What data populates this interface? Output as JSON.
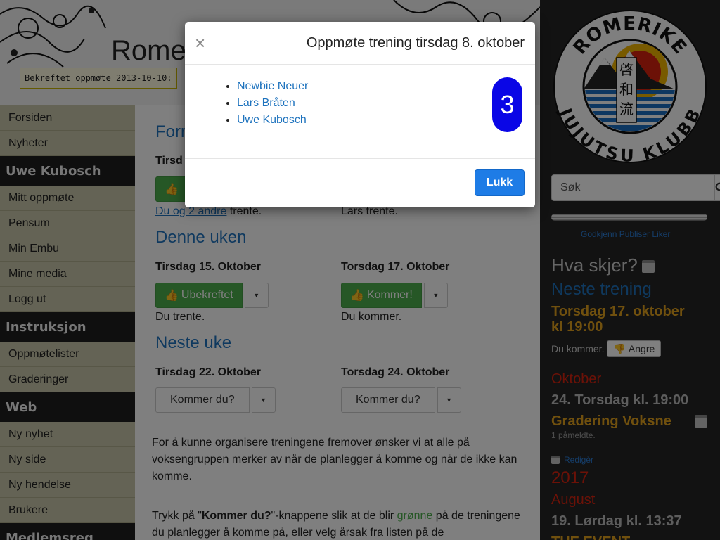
{
  "header": {
    "site_title": "Rome",
    "confirm_text": "Bekreftet oppmøte 2013-10-10:"
  },
  "nav": {
    "items_top": [
      "Forsiden",
      "Nyheter"
    ],
    "user_heading": "Uwe Kubosch",
    "user_items": [
      "Mitt oppmøte",
      "Pensum",
      "Min Embu",
      "Mine media",
      "Logg ut"
    ],
    "instr_heading": "Instruksjon",
    "instr_items": [
      "Oppmøtelister",
      "Graderinger"
    ],
    "web_heading": "Web",
    "web_items": [
      "Ny nyhet",
      "Ny side",
      "Ny hendelse",
      "Brukere"
    ],
    "member_heading": "Medlemsreg"
  },
  "main": {
    "section1_partial": "Forr",
    "day1_partial": "Tirsd",
    "status1_link": "Du og 2 andre",
    "status1_rest": " trente.",
    "status2": "Lars trente.",
    "this_week": "Denne uken",
    "tue15": "Tirsdag 15. Oktober",
    "thu17": "Torsdag 17. Oktober",
    "btn_unconfirmed": "Ubekreftet",
    "btn_coming": "Kommer!",
    "you_trained": "Du trente.",
    "you_coming": "Du kommer.",
    "next_week": "Neste uke",
    "tue22": "Tirsdag 22. Oktober",
    "thu24": "Torsdag 24. Oktober",
    "btn_coming_q": "Kommer du?",
    "para1": "For å kunne organisere treningene fremover ønsker vi at alle på voksengruppen merker av når de planlegger å komme og når de ikke kan komme.",
    "para2_a": "Trykk på \"",
    "para2_b": "Kommer du?",
    "para2_c": "\"-knappene slik at de blir ",
    "para2_green": "grønne",
    "para2_d": " på de treningene du planlegger å komme på, eller velg årsak fra listen på de"
  },
  "sidebar": {
    "logo_top": "ROMERIKE",
    "logo_bottom": "JUJUTSU KLUBB",
    "logo_kanji": [
      "啓",
      "和",
      "流"
    ],
    "search_placeholder": "Søk",
    "admin_links": "Godkjenn Publiser Liker",
    "whats_on": "Hva skjer?",
    "next_training": "Neste trening",
    "next_date": "Torsdag 17. oktober kl 19:00",
    "you_coming": "Du kommer.",
    "undo": "Angre",
    "month1": "Oktober",
    "event1": "24. Torsdag kl. 19:00",
    "event1_title": "Gradering Voksne",
    "event1_sub": "1 påmeldte.",
    "edit": "Redigèr",
    "year2": "2017",
    "month2": "August",
    "event2": "19. Lørdag kl. 13:37",
    "event2_title": "THE EVENT"
  },
  "modal": {
    "title": "Oppmøte trening tirsdag 8. oktober",
    "attendees": [
      "Newbie Neuer",
      "Lars Bråten",
      "Uwe Kubosch"
    ],
    "count": "3",
    "close_label": "Lukk",
    "close_x": "×"
  },
  "colors": {
    "link": "#1e73be",
    "green": "#4cae4c",
    "badge": "#0a06e6",
    "primary": "#1e7ce6",
    "gold": "#e0a01c",
    "red": "#d9230f"
  }
}
